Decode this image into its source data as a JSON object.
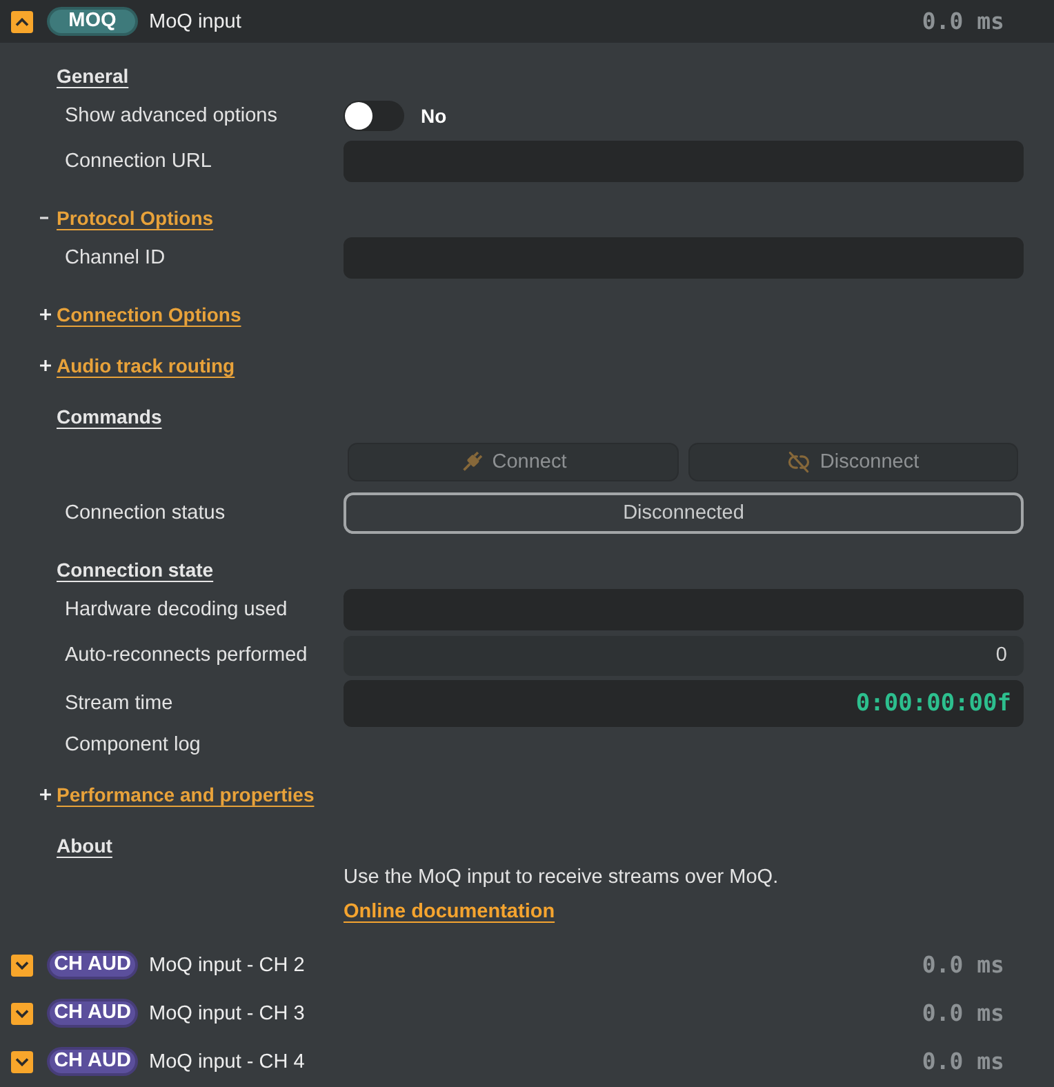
{
  "components": [
    {
      "badge": {
        "label": "MOQ",
        "color": "#3e7a7b"
      },
      "title": "MoQ input",
      "latency": "0.0 ms",
      "expanded": true,
      "sections": [
        {
          "kind": "heading",
          "title": "General",
          "rows": [
            {
              "kind": "toggle",
              "label": "Show advanced options",
              "on": false,
              "value": "No"
            },
            {
              "kind": "field",
              "label": "Connection URL"
            }
          ]
        },
        {
          "kind": "group",
          "title": "Protocol Options",
          "expanded": true,
          "rows": [
            {
              "kind": "field",
              "label": "Channel ID"
            }
          ]
        },
        {
          "kind": "group",
          "title": "Connection Options",
          "expanded": false
        },
        {
          "kind": "group",
          "title": "Audio track routing",
          "expanded": false
        },
        {
          "kind": "heading",
          "title": "Commands",
          "rows": [
            {
              "kind": "buttons",
              "buttons": [
                {
                  "label": "Connect",
                  "disabled": true
                },
                {
                  "label": "Disconnect",
                  "disabled": true
                }
              ]
            },
            {
              "kind": "status",
              "label": "Connection status",
              "value": "Disconnected"
            }
          ]
        },
        {
          "kind": "heading",
          "title": "Connection state",
          "rows": [
            {
              "kind": "readout",
              "label": "Hardware decoding used"
            },
            {
              "kind": "counter",
              "label": "Auto-reconnects performed",
              "value": "0"
            },
            {
              "kind": "timecode",
              "label": "Stream time",
              "value": "0:00:00:00f"
            },
            {
              "kind": "label",
              "label": "Component log"
            }
          ]
        },
        {
          "kind": "group",
          "title": "Performance and properties",
          "expanded": false
        },
        {
          "kind": "heading",
          "title": "About",
          "rows": [
            {
              "kind": "text",
              "text": "Use the MoQ input to receive streams over MoQ."
            },
            {
              "kind": "link",
              "text": "Online documentation"
            }
          ]
        }
      ]
    },
    {
      "badge": {
        "label": "CH AUD",
        "color": "#5b4f9c"
      },
      "title": "MoQ input - CH 2",
      "latency": "0.0 ms",
      "expanded": false
    },
    {
      "badge": {
        "label": "CH AUD",
        "color": "#5b4f9c"
      },
      "title": "MoQ input - CH 3",
      "latency": "0.0 ms",
      "expanded": false
    },
    {
      "badge": {
        "label": "CH AUD",
        "color": "#5b4f9c"
      },
      "title": "MoQ input - CH 4",
      "latency": "0.0 ms",
      "expanded": false
    }
  ]
}
